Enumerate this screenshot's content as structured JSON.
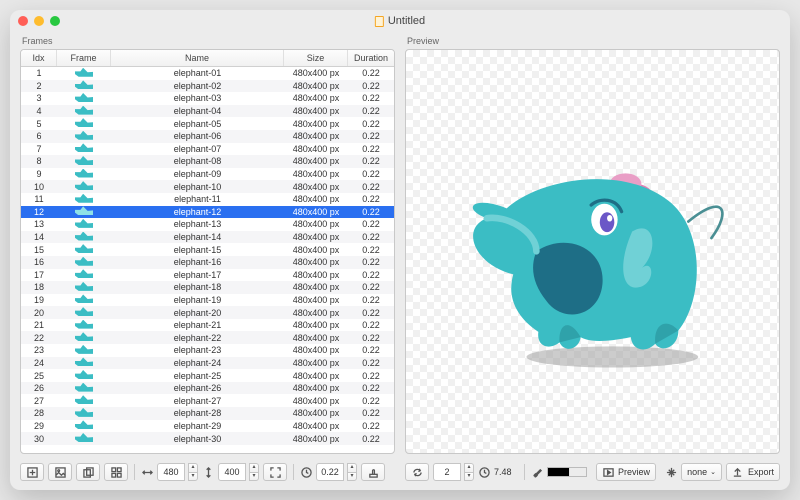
{
  "window": {
    "title": "Untitled"
  },
  "panels": {
    "frames_label": "Frames",
    "preview_label": "Preview"
  },
  "table": {
    "columns": {
      "idx": "Idx",
      "frame": "Frame",
      "name": "Name",
      "size": "Size",
      "duration": "Duration"
    },
    "selected_index": 12,
    "rows": [
      {
        "idx": 1,
        "name": "elephant-01",
        "size": "480x400 px",
        "duration": "0.22"
      },
      {
        "idx": 2,
        "name": "elephant-02",
        "size": "480x400 px",
        "duration": "0.22"
      },
      {
        "idx": 3,
        "name": "elephant-03",
        "size": "480x400 px",
        "duration": "0.22"
      },
      {
        "idx": 4,
        "name": "elephant-04",
        "size": "480x400 px",
        "duration": "0.22"
      },
      {
        "idx": 5,
        "name": "elephant-05",
        "size": "480x400 px",
        "duration": "0.22"
      },
      {
        "idx": 6,
        "name": "elephant-06",
        "size": "480x400 px",
        "duration": "0.22"
      },
      {
        "idx": 7,
        "name": "elephant-07",
        "size": "480x400 px",
        "duration": "0.22"
      },
      {
        "idx": 8,
        "name": "elephant-08",
        "size": "480x400 px",
        "duration": "0.22"
      },
      {
        "idx": 9,
        "name": "elephant-09",
        "size": "480x400 px",
        "duration": "0.22"
      },
      {
        "idx": 10,
        "name": "elephant-10",
        "size": "480x400 px",
        "duration": "0.22"
      },
      {
        "idx": 11,
        "name": "elephant-11",
        "size": "480x400 px",
        "duration": "0.22"
      },
      {
        "idx": 12,
        "name": "elephant-12",
        "size": "480x400 px",
        "duration": "0.22"
      },
      {
        "idx": 13,
        "name": "elephant-13",
        "size": "480x400 px",
        "duration": "0.22"
      },
      {
        "idx": 14,
        "name": "elephant-14",
        "size": "480x400 px",
        "duration": "0.22"
      },
      {
        "idx": 15,
        "name": "elephant-15",
        "size": "480x400 px",
        "duration": "0.22"
      },
      {
        "idx": 16,
        "name": "elephant-16",
        "size": "480x400 px",
        "duration": "0.22"
      },
      {
        "idx": 17,
        "name": "elephant-17",
        "size": "480x400 px",
        "duration": "0.22"
      },
      {
        "idx": 18,
        "name": "elephant-18",
        "size": "480x400 px",
        "duration": "0.22"
      },
      {
        "idx": 19,
        "name": "elephant-19",
        "size": "480x400 px",
        "duration": "0.22"
      },
      {
        "idx": 20,
        "name": "elephant-20",
        "size": "480x400 px",
        "duration": "0.22"
      },
      {
        "idx": 21,
        "name": "elephant-21",
        "size": "480x400 px",
        "duration": "0.22"
      },
      {
        "idx": 22,
        "name": "elephant-22",
        "size": "480x400 px",
        "duration": "0.22"
      },
      {
        "idx": 23,
        "name": "elephant-23",
        "size": "480x400 px",
        "duration": "0.22"
      },
      {
        "idx": 24,
        "name": "elephant-24",
        "size": "480x400 px",
        "duration": "0.22"
      },
      {
        "idx": 25,
        "name": "elephant-25",
        "size": "480x400 px",
        "duration": "0.22"
      },
      {
        "idx": 26,
        "name": "elephant-26",
        "size": "480x400 px",
        "duration": "0.22"
      },
      {
        "idx": 27,
        "name": "elephant-27",
        "size": "480x400 px",
        "duration": "0.22"
      },
      {
        "idx": 28,
        "name": "elephant-28",
        "size": "480x400 px",
        "duration": "0.22"
      },
      {
        "idx": 29,
        "name": "elephant-29",
        "size": "480x400 px",
        "duration": "0.22"
      },
      {
        "idx": 30,
        "name": "elephant-30",
        "size": "480x400 px",
        "duration": "0.22"
      }
    ]
  },
  "left_toolbar": {
    "width": "480",
    "height": "400",
    "duration": "0.22"
  },
  "right_toolbar": {
    "frame_number": "2",
    "total_time": "7.48",
    "preview_label": "Preview",
    "scale_label": "none",
    "export_label": "Export"
  }
}
